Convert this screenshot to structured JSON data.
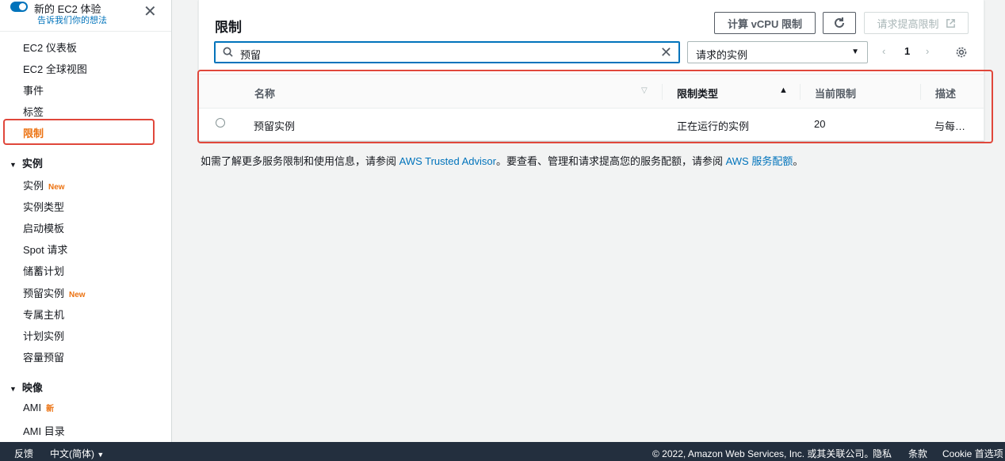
{
  "sidebar": {
    "experience_title": "新的 EC2 体验",
    "experience_link": "告诉我们你的想法",
    "items_top": [
      "EC2 仪表板",
      "EC2 全球视图",
      "事件",
      "标签",
      "限制"
    ],
    "section_instances": "实例",
    "instances_items": [
      {
        "label": "实例",
        "badge": "New"
      },
      {
        "label": "实例类型",
        "badge": ""
      },
      {
        "label": "启动模板",
        "badge": ""
      },
      {
        "label": "Spot 请求",
        "badge": ""
      },
      {
        "label": "储蓄计划",
        "badge": ""
      },
      {
        "label": "预留实例",
        "badge": "New"
      },
      {
        "label": "专属主机",
        "badge": ""
      },
      {
        "label": "计划实例",
        "badge": ""
      },
      {
        "label": "容量预留",
        "badge": ""
      }
    ],
    "section_images": "映像",
    "images_items": [
      {
        "label": "AMI",
        "badge": "新"
      },
      {
        "label": "AMI 目录",
        "badge": ""
      }
    ]
  },
  "panel": {
    "title": "限制",
    "btn_calc": "计算 vCPU 限制",
    "btn_request": "请求提高限制",
    "search_value": "预留",
    "filter_value": "请求的实例",
    "page": "1",
    "columns": [
      "名称",
      "限制类型",
      "当前限制",
      "描述"
    ],
    "rows": [
      {
        "name": "预留实例",
        "type": "正在运行的实例",
        "limit": "20",
        "desc": "与每…"
      }
    ]
  },
  "info": {
    "prefix": "如需了解更多服务限制和使用信息，请参阅 ",
    "link1": "AWS Trusted Advisor",
    "middle": "。要查看、管理和请求提高您的服务配额，请参阅 ",
    "link2": "AWS 服务配额",
    "suffix": "。"
  },
  "footer": {
    "feedback": "反馈",
    "language": "中文(简体)",
    "copyright": "© 2022, Amazon Web Services, Inc. 或其关联公司。",
    "privacy": "隐私",
    "terms": "条款",
    "cookies": "Cookie 首选项"
  },
  "colors": {
    "accent": "#0073bb",
    "active": "#ec7211",
    "highlight": "#e0473b",
    "footer_bg": "#232f3e"
  }
}
